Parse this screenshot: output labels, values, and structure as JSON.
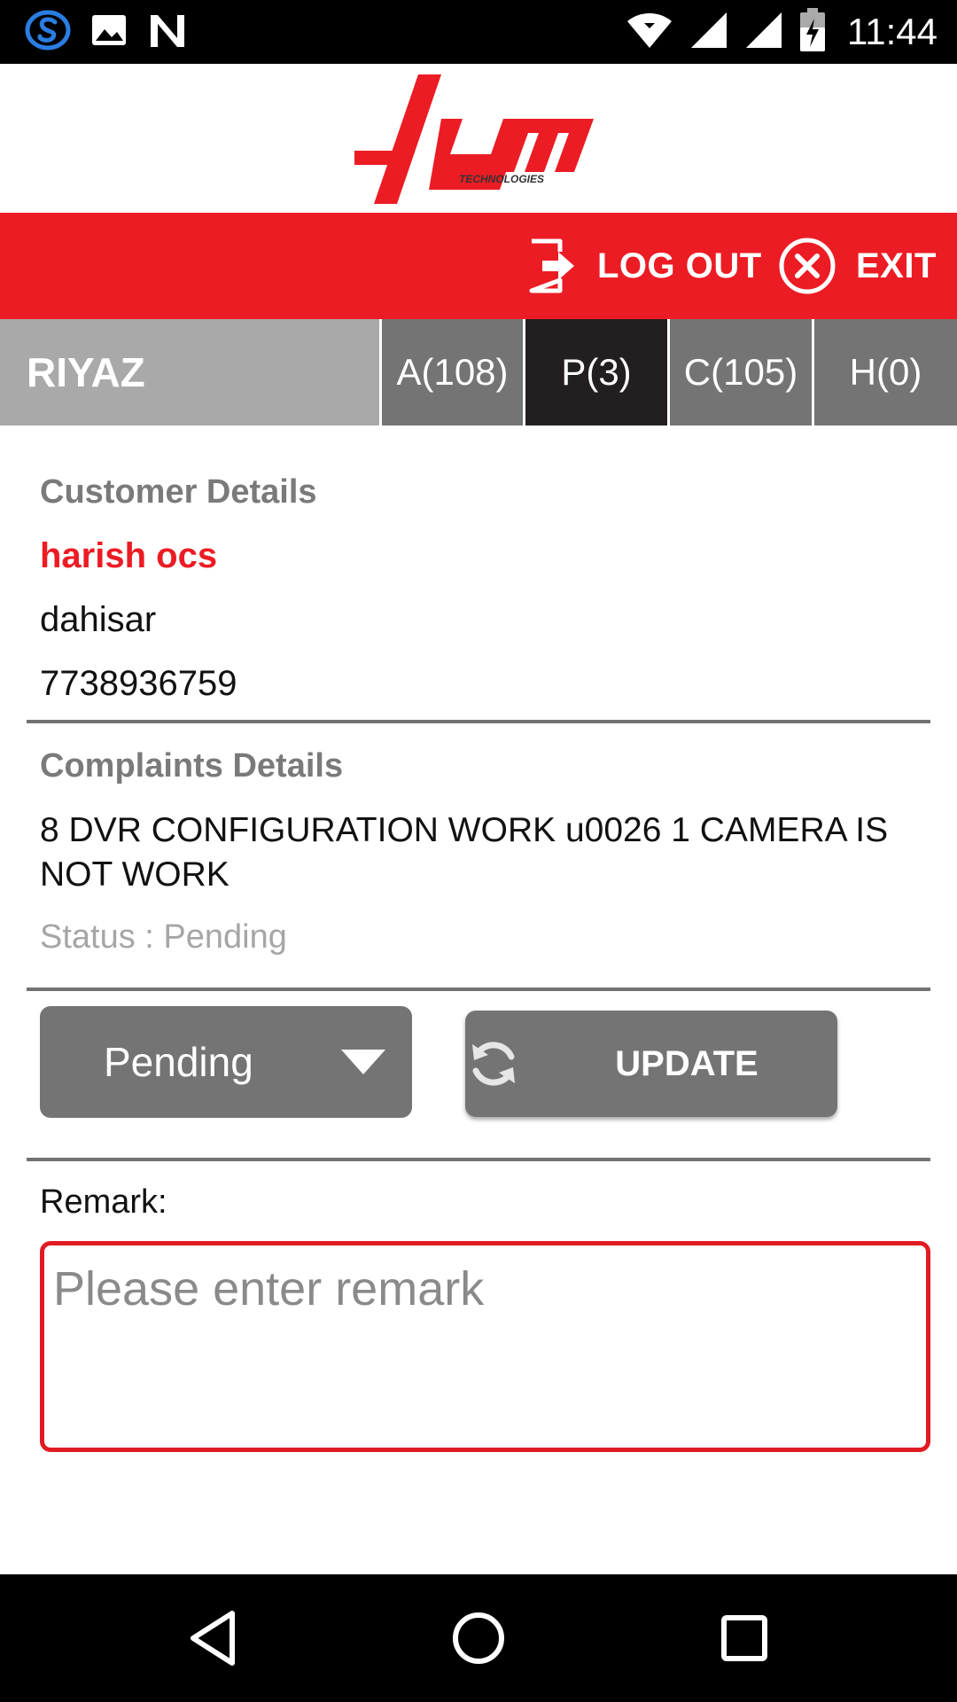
{
  "status_bar": {
    "time": "11:44",
    "icons": [
      "skype-icon",
      "image-icon",
      "n-notification-icon",
      "wifi-icon",
      "signal-icon",
      "signal-icon-2",
      "battery-charging-icon"
    ]
  },
  "header": {
    "logo_icon": "lym-technologies-logo",
    "logo_text": "lym",
    "logo_subtext": "TECHNOLOGIES"
  },
  "action_bar": {
    "logout_label": "LOG OUT",
    "logout_icon": "logout-icon",
    "exit_label": "EXIT",
    "exit_icon": "close-circle-icon"
  },
  "tabs_row": {
    "user_name": "RIYAZ",
    "tabs": [
      {
        "label": "A(108)",
        "active": false
      },
      {
        "label": "P(3)",
        "active": true
      },
      {
        "label": "C(105)",
        "active": false
      },
      {
        "label": "H(0)",
        "active": false
      }
    ]
  },
  "customer": {
    "section_title": "Customer Details",
    "name": "harish ocs",
    "location": "dahisar",
    "phone": "7738936759"
  },
  "complaint": {
    "section_title": "Complaints Details",
    "description": "8 DVR CONFIGURATION WORK u0026 1 CAMERA IS NOT WORK",
    "status_text": "Status : Pending"
  },
  "controls": {
    "status_select_value": "Pending",
    "update_label": "UPDATE",
    "update_icon": "refresh-icon"
  },
  "remark": {
    "label": "Remark:",
    "placeholder": "Please enter remark",
    "value": ""
  },
  "nav_bar": {
    "icons": [
      "back-icon",
      "home-icon",
      "recents-icon"
    ]
  },
  "colors": {
    "brand_red": "#ec1c24",
    "tab_gray": "#747474",
    "tab_active": "#231f20",
    "user_cell": "#a9a9a9"
  }
}
